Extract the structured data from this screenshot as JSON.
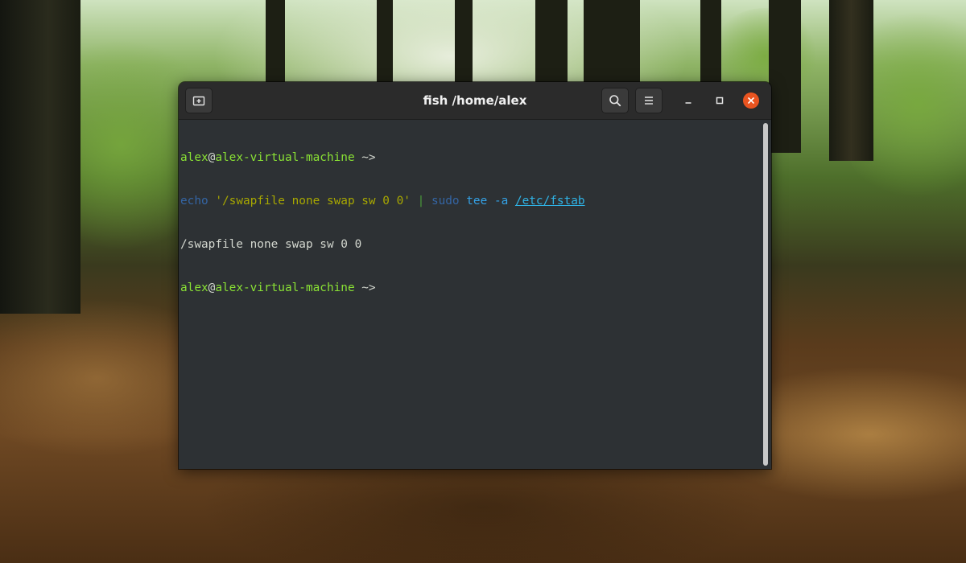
{
  "window": {
    "title": "fish /home/alex"
  },
  "headerbar": {
    "new_tab_icon": "new-tab-icon",
    "search_icon": "search-icon",
    "menu_icon": "hamburger-menu-icon",
    "minimize_icon": "minimize-icon",
    "maximize_icon": "maximize-icon",
    "close_icon": "close-icon"
  },
  "terminal": {
    "prompt1": {
      "user": "alex",
      "at": "@",
      "host": "alex-virtual-machine",
      "cwd_arrow": " ~>"
    },
    "command": {
      "cmd": "echo",
      "arg": "'/swapfile none swap sw 0 0'",
      "pipe": "|",
      "sudo": "sudo",
      "tee": "tee",
      "flag": "-a",
      "path": "/etc/fstab"
    },
    "output": "/swapfile none swap sw 0 0",
    "prompt2": {
      "user": "alex",
      "at": "@",
      "host": "alex-virtual-machine",
      "cwd_arrow": " ~>"
    }
  },
  "colors": {
    "accent_close": "#e95420",
    "terminal_bg": "#2d3134",
    "headerbar_bg": "#2b2b2b"
  }
}
